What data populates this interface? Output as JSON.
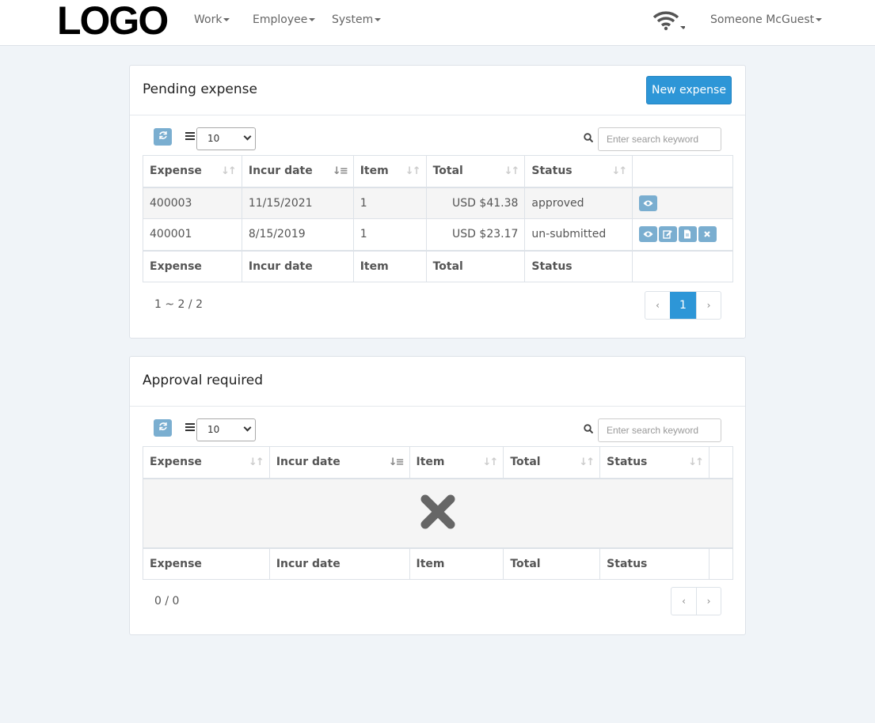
{
  "nav": {
    "logo": "LOGO",
    "menu": [
      "Work",
      "Employee",
      "System"
    ],
    "user": "Someone McGuest"
  },
  "pending": {
    "title": "Pending expense",
    "new_button": "New expense",
    "page_size": "10",
    "search_placeholder": "Enter search keyword",
    "columns": [
      "Expense",
      "Incur date",
      "Item",
      "Total",
      "Status"
    ],
    "rows": [
      {
        "expense": "400003",
        "date": "11/15/2021",
        "item": "1",
        "total": "USD $41.38",
        "status": "approved"
      },
      {
        "expense": "400001",
        "date": "8/15/2019",
        "item": "1",
        "total": "USD $23.17",
        "status": "un-submitted"
      }
    ],
    "info": "1 ~ 2 / 2",
    "pager": {
      "prev": "‹",
      "page": "1",
      "next": "›"
    }
  },
  "approval": {
    "title": "Approval required",
    "page_size": "10",
    "search_placeholder": "Enter search keyword",
    "columns": [
      "Expense",
      "Incur date",
      "Item",
      "Total",
      "Status"
    ],
    "info": "0 / 0",
    "pager": {
      "prev": "‹",
      "next": "›"
    }
  },
  "icons": {
    "refresh": "refresh-icon",
    "list": "list-icon",
    "search": "search-icon",
    "view": "eye-icon",
    "edit": "edit-icon",
    "doc": "document-icon",
    "delete": "close-icon",
    "empty": "x-icon",
    "wifi": "wifi-icon"
  },
  "colors": {
    "primary": "#2d96d7",
    "action": "#7aaed0",
    "background": "#f0f4f8"
  }
}
